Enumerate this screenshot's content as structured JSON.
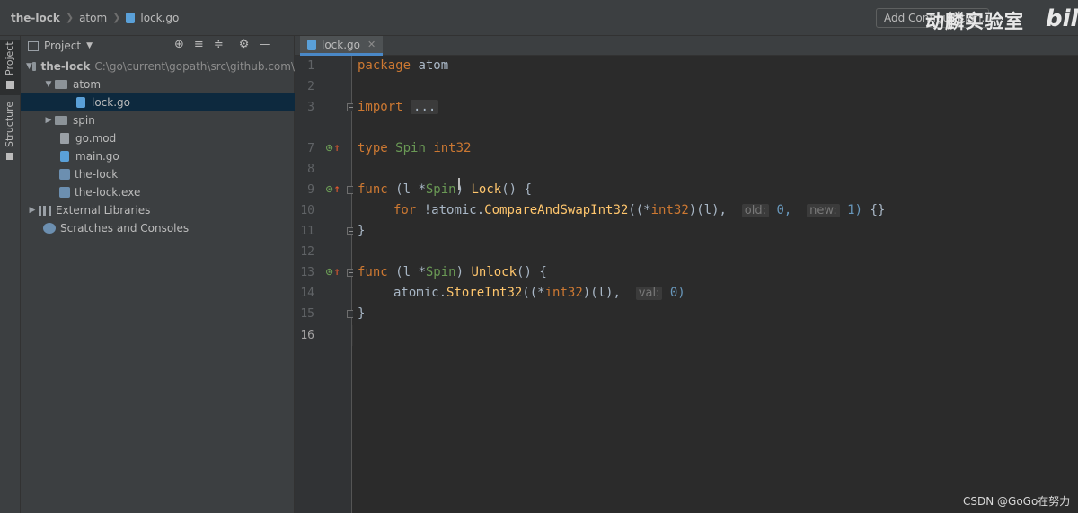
{
  "breadcrumb": {
    "project": "the-lock",
    "folder": "atom",
    "file": "lock.go"
  },
  "toolbar": {
    "add_configuration": "Add Configuration..."
  },
  "watermark": {
    "text": "动麟实验室",
    "logo": "bili"
  },
  "side_tabs": {
    "project": "Project",
    "structure": "Structure"
  },
  "project_panel": {
    "title": "Project",
    "icons": [
      "locate-icon",
      "expand-all-icon",
      "collapse-all-icon",
      "gear-icon",
      "minimize-icon"
    ],
    "tree": [
      {
        "label": "the-lock",
        "path": "C:\\go\\current\\gopath\\src\\github.com\\",
        "type": "folder",
        "expanded": true
      },
      {
        "label": "atom",
        "type": "folder",
        "expanded": true
      },
      {
        "label": "lock.go",
        "type": "go-file",
        "selected": true
      },
      {
        "label": "spin",
        "type": "folder",
        "expanded": false
      },
      {
        "label": "go.mod",
        "type": "mod-file"
      },
      {
        "label": "main.go",
        "type": "go-file"
      },
      {
        "label": "the-lock",
        "type": "exe-file"
      },
      {
        "label": "the-lock.exe",
        "type": "exe-file"
      },
      {
        "label": "External Libraries",
        "type": "libraries"
      },
      {
        "label": "Scratches and Consoles",
        "type": "scratches"
      }
    ]
  },
  "editor": {
    "tab": "lock.go",
    "line_numbers": [
      "1",
      "2",
      "3",
      "7",
      "8",
      "9",
      "10",
      "11",
      "12",
      "13",
      "14",
      "15",
      "16"
    ],
    "code": {
      "l1_kw": "package",
      "l1_name": "atom",
      "l3_kw": "import",
      "l3_folded": "...",
      "l7_kw": "type",
      "l7_name": "Spin",
      "l7_type": "int32",
      "l9_kw": "func",
      "l9_open": "(l *",
      "l9_recv": "Spin",
      "l9_close": ")",
      "l9_fn": "Lock",
      "l9_tail": "() {",
      "l10_kw": "for",
      "l10_a": "!atomic.",
      "l10_fn": "CompareAndSwapInt32",
      "l10_b": "((*",
      "l10_ty": "int32",
      "l10_c": ")(l),",
      "l10_hint1": "old:",
      "l10_v1": "0,",
      "l10_hint2": "new:",
      "l10_v2": "1)",
      "l10_d": "{}",
      "l11": "}",
      "l13_kw": "func",
      "l13_open": "(l *",
      "l13_recv": "Spin",
      "l13_close": ")",
      "l13_fn": "Unlock",
      "l13_tail": "() {",
      "l14_a": "atomic.",
      "l14_fn": "StoreInt32",
      "l14_b": "((*",
      "l14_ty": "int32",
      "l14_c": ")(l),",
      "l14_hint": "val:",
      "l14_v": "0)",
      "l15": "}"
    }
  },
  "footer": {
    "credit": "CSDN @GoGo在努力"
  }
}
